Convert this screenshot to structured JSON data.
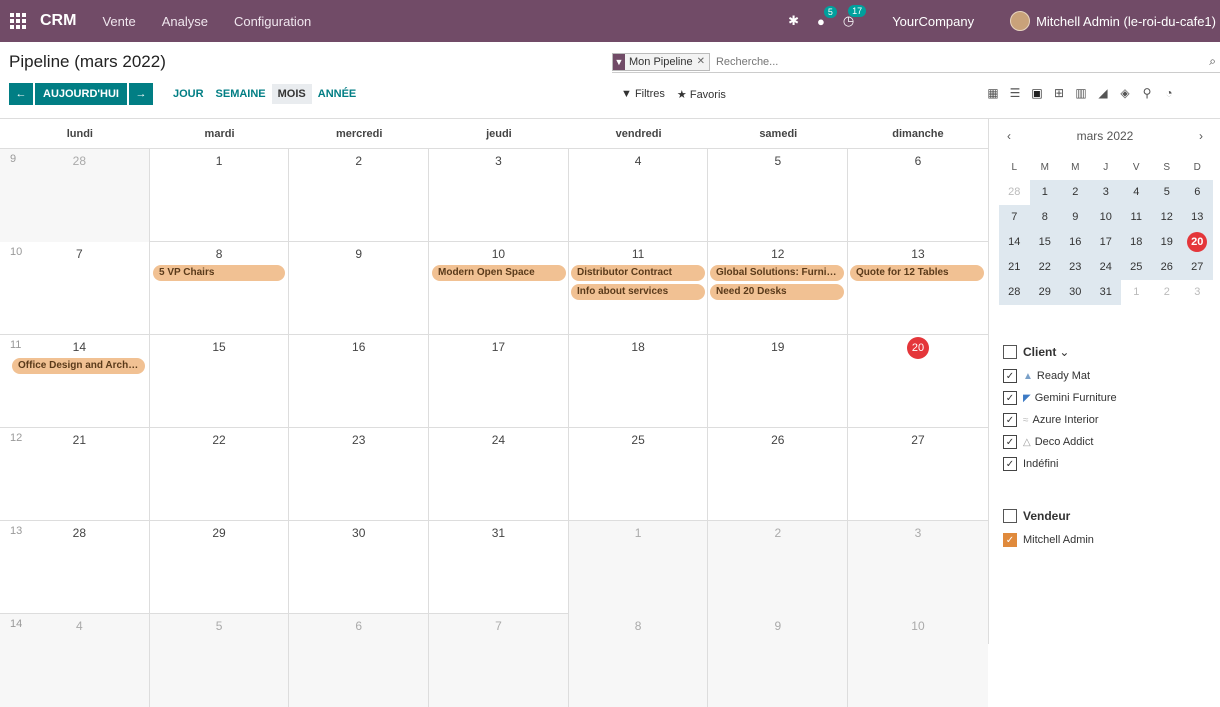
{
  "navbar": {
    "brand": "CRM",
    "menus": [
      "Vente",
      "Analyse",
      "Configuration"
    ],
    "activity_badge": "5",
    "clock_badge": "17",
    "company": "YourCompany",
    "user": "Mitchell Admin (le-roi-du-cafe1)"
  },
  "page": {
    "title": "Pipeline (mars 2022)"
  },
  "search": {
    "facet": "Mon Pipeline",
    "placeholder": "Recherche..."
  },
  "toolbar": {
    "today": "AUJOURD'HUI",
    "prev": "←",
    "next": "→",
    "scales": [
      "JOUR",
      "SEMAINE",
      "MOIS",
      "ANNÉE"
    ],
    "active_scale": "MOIS",
    "filters": "Filtres",
    "favorites": "Favoris"
  },
  "calendar": {
    "weekdays": [
      "lundi",
      "mardi",
      "mercredi",
      "jeudi",
      "vendredi",
      "samedi",
      "dimanche"
    ],
    "weeks": [
      {
        "num": "9",
        "days": [
          "28",
          "1",
          "2",
          "3",
          "4",
          "5",
          "6"
        ]
      },
      {
        "num": "10",
        "days": [
          "7",
          "8",
          "9",
          "10",
          "11",
          "12",
          "13"
        ]
      },
      {
        "num": "11",
        "days": [
          "14",
          "15",
          "16",
          "17",
          "18",
          "19",
          "20"
        ]
      },
      {
        "num": "12",
        "days": [
          "21",
          "22",
          "23",
          "24",
          "25",
          "26",
          "27"
        ]
      },
      {
        "num": "13",
        "days": [
          "28",
          "29",
          "30",
          "31",
          "1",
          "2",
          "3"
        ]
      },
      {
        "num": "14",
        "days": [
          "4",
          "5",
          "6",
          "7",
          "8",
          "9",
          "10"
        ]
      }
    ],
    "events": [
      "5 VP Chairs",
      "Modern Open Space",
      "Distributor Contract",
      "Info about services",
      "Global Solutions: Furnitu...",
      "Need 20 Desks",
      "Quote for 12 Tables",
      "Office Design and Archit..."
    ],
    "event_color": "#f1c193"
  },
  "mini_calendar": {
    "title": "mars 2022",
    "dow": [
      "L",
      "M",
      "M",
      "J",
      "V",
      "S",
      "D"
    ],
    "weeks": [
      [
        "28",
        "1",
        "2",
        "3",
        "4",
        "5",
        "6"
      ],
      [
        "7",
        "8",
        "9",
        "10",
        "11",
        "12",
        "13"
      ],
      [
        "14",
        "15",
        "16",
        "17",
        "18",
        "19",
        "20"
      ],
      [
        "21",
        "22",
        "23",
        "24",
        "25",
        "26",
        "27"
      ],
      [
        "28",
        "29",
        "30",
        "31",
        "1",
        "2",
        "3"
      ]
    ]
  },
  "sidebar": {
    "client_title": "Client",
    "clients": [
      "Ready Mat",
      "Gemini Furniture",
      "Azure Interior",
      "Deco Addict",
      "Indéfini"
    ],
    "vendor_title": "Vendeur",
    "vendors": [
      "Mitchell Admin"
    ]
  },
  "colors": {
    "brand": "#714b67",
    "primary": "#017e84",
    "today": "#e4363a"
  }
}
